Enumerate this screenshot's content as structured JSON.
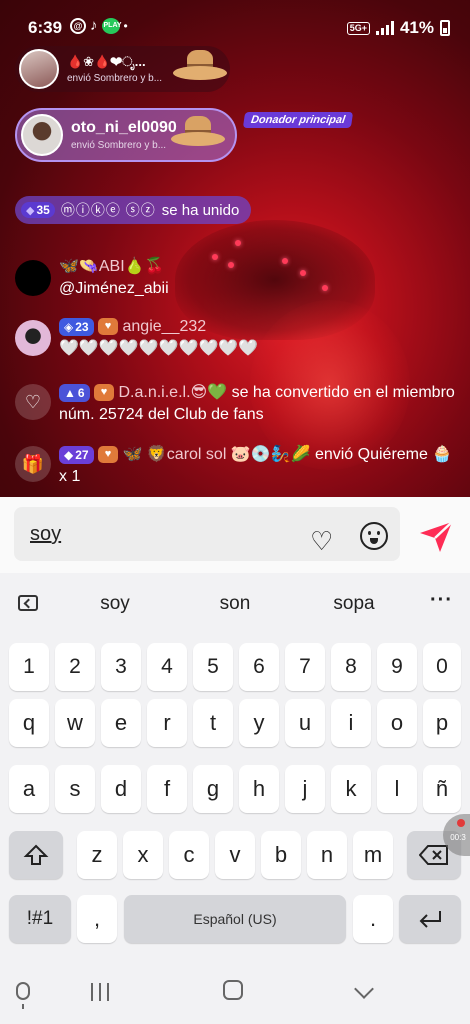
{
  "status_bar": {
    "time": "6:39",
    "app_icons": [
      "@",
      "♪",
      "PLAY"
    ],
    "network": "5G+",
    "battery": "41%"
  },
  "gift_banners": [
    {
      "name": "🩸❀🩸❤ೃ...",
      "sub": "envió Sombrero y b..."
    },
    {
      "name": "oto_ni_el0090",
      "sub": "envió Sombrero y b...",
      "badge": "Donador principal"
    }
  ],
  "join": {
    "level": "35",
    "user": "ⓜⓘⓚⓔ ⓢⓩ",
    "text": "se ha unido"
  },
  "chat": [
    {
      "name": "🦋👒ABI🍐🍒",
      "message": "@Jiménez_abii"
    },
    {
      "level": "23",
      "name": "angie__232",
      "message": "🤍🤍🤍🤍🤍🤍🤍🤍🤍🤍"
    },
    {
      "level": "6",
      "name": "D.a.n.i.e.l.😎💚",
      "message": "se ha convertido en el miembro núm. 25724 del Club de fans"
    },
    {
      "level": "27",
      "name": "🦋 🦁carol sol 🐷💿🧞🌽",
      "message": "envió Quiéreme 🧁 x 1"
    }
  ],
  "comment": {
    "value": "soy"
  },
  "suggestions": [
    "soy",
    "son",
    "sopa"
  ],
  "keyboard": {
    "row_numbers": [
      "1",
      "2",
      "3",
      "4",
      "5",
      "6",
      "7",
      "8",
      "9",
      "0"
    ],
    "row1": [
      "q",
      "w",
      "e",
      "r",
      "t",
      "y",
      "u",
      "i",
      "o",
      "p"
    ],
    "row2": [
      "a",
      "s",
      "d",
      "f",
      "g",
      "h",
      "j",
      "k",
      "l",
      "ñ"
    ],
    "row3": [
      "z",
      "x",
      "c",
      "v",
      "b",
      "n",
      "m"
    ],
    "symbols": "!#1",
    "comma": ",",
    "space": "Español (US)",
    "period": ".",
    "record_time": "00:3"
  },
  "colors": {
    "stream_red": "#b40f1a",
    "send_red": "#fe2c55",
    "donor_purple": "#6a3ad8"
  }
}
